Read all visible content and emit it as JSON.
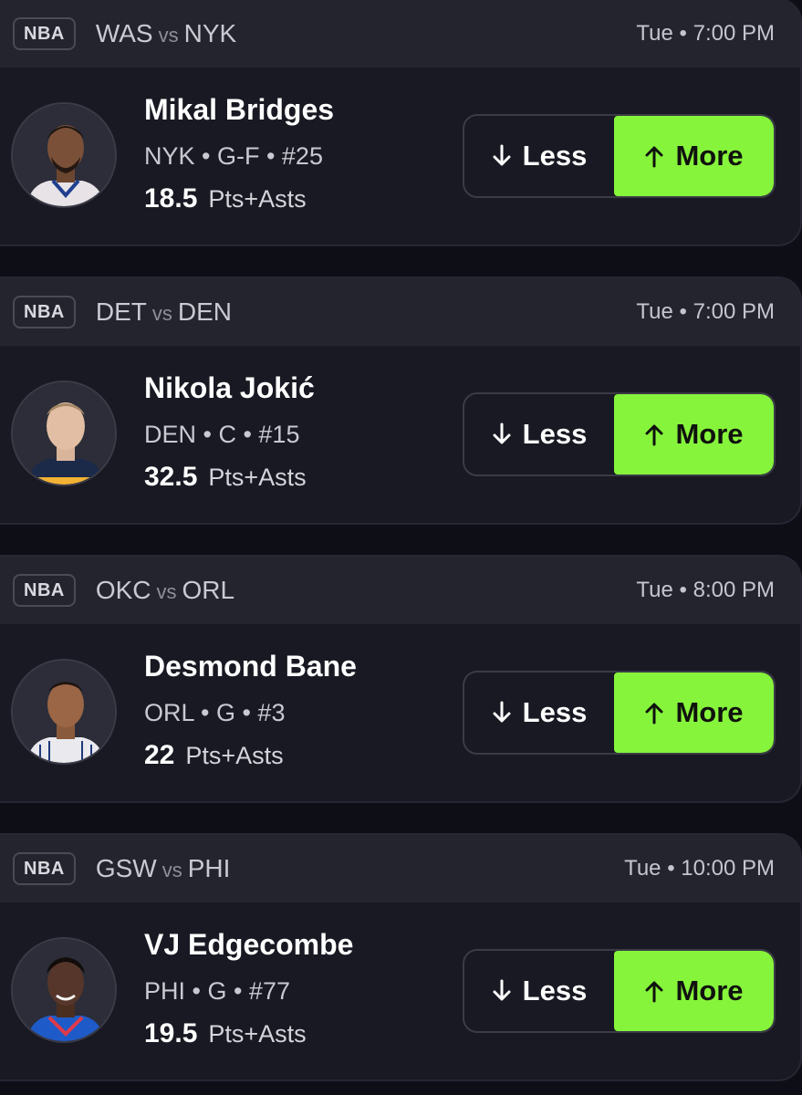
{
  "cards": [
    {
      "league": "NBA",
      "home_team": "WAS",
      "vs": "vs",
      "away_team": "NYK",
      "time": "Tue • 7:00 PM",
      "player": {
        "name": "Mikal Bridges",
        "meta": "NYK • G-F • #25",
        "stat_value": "18.5",
        "stat_type": "Pts+Asts"
      },
      "less_label": "Less",
      "more_label": "More",
      "jersey_color": "#e7e3e6"
    },
    {
      "league": "NBA",
      "home_team": "DET",
      "vs": "vs",
      "away_team": "DEN",
      "time": "Tue • 7:00 PM",
      "player": {
        "name": "Nikola Jokić",
        "meta": "DEN • C • #15",
        "stat_value": "32.5",
        "stat_type": "Pts+Asts"
      },
      "less_label": "Less",
      "more_label": "More",
      "jersey_color": "#1c2a4a"
    },
    {
      "league": "NBA",
      "home_team": "OKC",
      "vs": "vs",
      "away_team": "ORL",
      "time": "Tue • 8:00 PM",
      "player": {
        "name": "Desmond Bane",
        "meta": "ORL • G • #3",
        "stat_value": "22",
        "stat_type": "Pts+Asts"
      },
      "less_label": "Less",
      "more_label": "More",
      "jersey_color": "#e9e9ee"
    },
    {
      "league": "NBA",
      "home_team": "GSW",
      "vs": "vs",
      "away_team": "PHI",
      "time": "Tue • 10:00 PM",
      "player": {
        "name": "VJ Edgecombe",
        "meta": "PHI • G • #77",
        "stat_value": "19.5",
        "stat_type": "Pts+Asts"
      },
      "less_label": "Less",
      "more_label": "More",
      "jersey_color": "#1f5bc8"
    }
  ],
  "colors": {
    "more_button": "#86f43b",
    "card_bg": "#181922",
    "header_bg": "#23242e"
  },
  "icons": {
    "less": "arrow-down-icon",
    "more": "arrow-up-icon"
  }
}
